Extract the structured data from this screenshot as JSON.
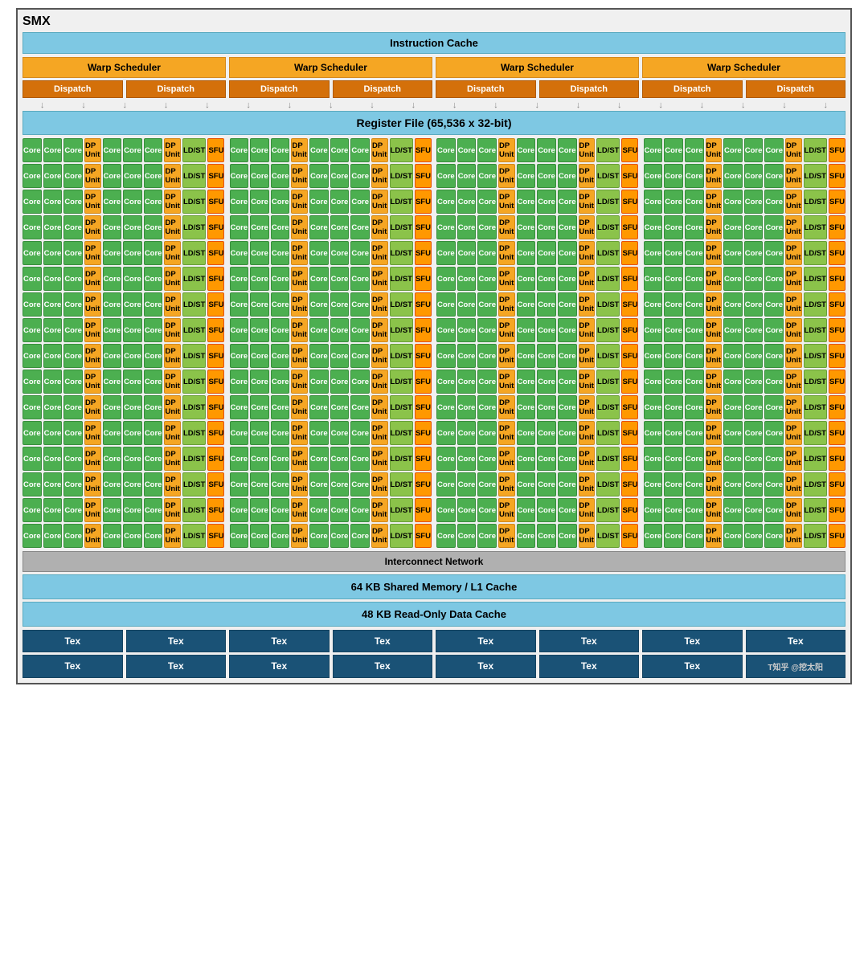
{
  "title": "SMX",
  "instruction_cache": "Instruction Cache",
  "warp_schedulers": [
    "Warp Scheduler",
    "Warp Scheduler",
    "Warp Scheduler",
    "Warp Scheduler"
  ],
  "dispatch_units": [
    "Dispatch",
    "Dispatch",
    "Dispatch",
    "Dispatch",
    "Dispatch",
    "Dispatch",
    "Dispatch",
    "Dispatch"
  ],
  "register_file": "Register File (65,536 x 32-bit)",
  "cells": {
    "core": "Core",
    "dp_unit": "DP Unit",
    "ldst": "LD/ST",
    "sfu": "SFU"
  },
  "num_core_rows": 16,
  "interconnect": "Interconnect Network",
  "shared_memory": "64 KB Shared Memory / L1 Cache",
  "read_only_cache": "48 KB Read-Only Data Cache",
  "tex_units": [
    "Tex",
    "Tex",
    "Tex",
    "Tex",
    "Tex",
    "Tex",
    "Tex",
    "Tex"
  ],
  "tex_units_row2": [
    "Tex",
    "Tex",
    "Tex",
    "Tex",
    "Tex",
    "Tex",
    "T知乎 @挖太阳"
  ],
  "watermark": "T知乎 @挖太阳"
}
